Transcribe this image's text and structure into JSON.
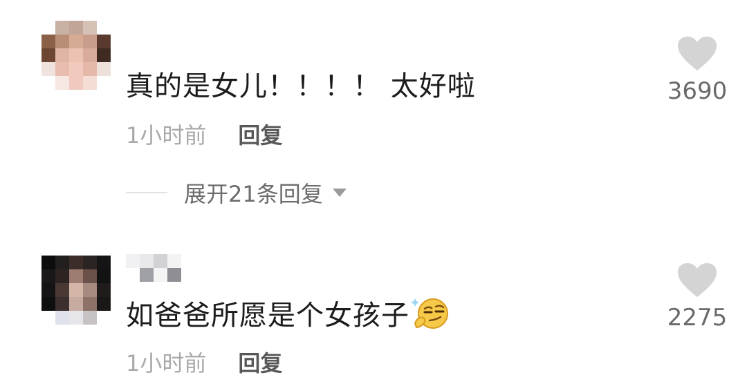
{
  "comments": [
    {
      "text": "真的是女儿！！！！ 太好啦",
      "time": "1小时前",
      "reply_label": "回复",
      "like_count": "3690",
      "icon": "heart-icon"
    },
    {
      "text": "如爸爸所愿是个女孩子",
      "time": "1小时前",
      "reply_label": "回复",
      "like_count": "2275",
      "icon": "heart-icon",
      "emoji": "smirk-emoji-icon"
    }
  ],
  "expand_replies": {
    "label": "展开21条回复",
    "icon": "caret-down-icon"
  },
  "colors": {
    "comment_text": "#1c1c1c",
    "time_text": "#a9a9ab",
    "reply_text": "#585858",
    "like_icon": "#d4d4d4",
    "like_count": "#6a6a6a",
    "expand_text": "#6c6c6c"
  }
}
